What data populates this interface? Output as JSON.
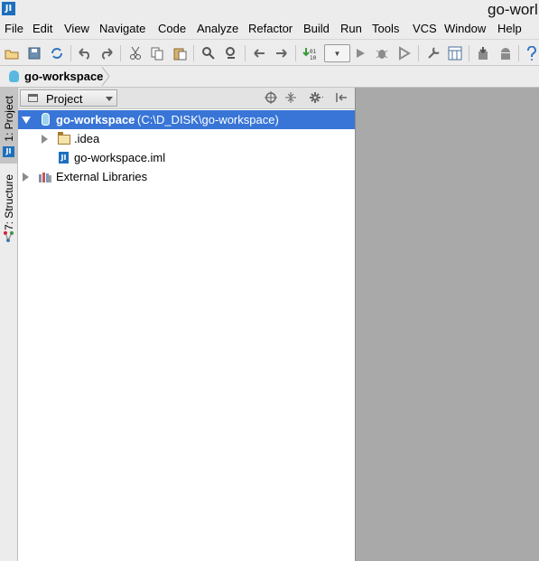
{
  "window": {
    "title": "go-worl",
    "app_icon_text": "JI"
  },
  "menu": [
    "File",
    "Edit",
    "View",
    "Navigate",
    "Code",
    "Analyze",
    "Refactor",
    "Build",
    "Run",
    "Tools",
    "VCS",
    "Window",
    "Help"
  ],
  "toolbar": {
    "buttons": [
      "open-folder",
      "save-all",
      "synchronize",
      "undo",
      "redo",
      "cut",
      "copy",
      "paste",
      "find",
      "replace",
      "back",
      "forward",
      "make-project",
      "run",
      "debug",
      "run-with-coverage",
      "settings",
      "project-structure",
      "sdk-manager",
      "android-device",
      "help"
    ],
    "run_config_value": ""
  },
  "navbar": {
    "breadcrumb": "go-workspace"
  },
  "side_tabs": [
    {
      "label": "1: Project",
      "active": true
    },
    {
      "label": "7: Structure",
      "active": false
    }
  ],
  "project_panel": {
    "view_selector": "Project",
    "header_buttons": [
      "scroll-from-source",
      "collapse-all",
      "settings",
      "hide"
    ],
    "tree": [
      {
        "label": "go-workspace",
        "path": "(C:\\D_DISK\\go-workspace)",
        "expanded": true,
        "selected": true
      },
      {
        "label": ".idea",
        "expanded": false
      },
      {
        "label": "go-workspace.iml"
      },
      {
        "label": "External Libraries",
        "expanded": false
      }
    ]
  },
  "colors": {
    "selection": "#3875d7",
    "editor_background": "#a9a9a9",
    "chrome": "#ececec"
  }
}
